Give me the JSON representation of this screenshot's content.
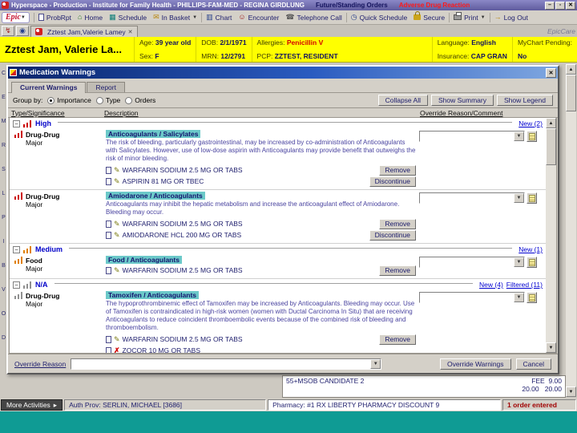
{
  "icons": {
    "close": "✕",
    "minimize": "–",
    "maximize": "▫",
    "dropdown": "▼",
    "up": "▲",
    "down": "▼",
    "collapse": "−",
    "edit": "✎",
    "removed": "✗",
    "home": "⌂",
    "mail": "✉",
    "phone": "☎",
    "clock": "◷",
    "chart": "▥",
    "person": "☺",
    "calendar": "▦",
    "logout": "→",
    "bolt": "↯",
    "globe": "◉",
    "more": "▸",
    "tab_close": "✕"
  },
  "titlebar": {
    "title": "Hyperspace - Production - Institute for Family Health - PHILLIPS-FAM-MED - REGINA GIRDLUNG",
    "alert_orders": "Future/Standing Orders",
    "alert_adr": "Adverse Drug Reaction"
  },
  "toolbar": {
    "epic": "Epic",
    "items": [
      {
        "label": "ProbRpt"
      },
      {
        "label": "Home"
      },
      {
        "label": "Schedule"
      },
      {
        "label": "In Basket"
      },
      {
        "label": "Chart"
      },
      {
        "label": "Encounter"
      },
      {
        "label": "Telephone Call"
      },
      {
        "label": "Quick Schedule"
      },
      {
        "label": "Secure"
      },
      {
        "label": "Print"
      },
      {
        "label": "Log Out"
      }
    ]
  },
  "tabrow": {
    "tab": "Zztest Jam,Valerie Lamey",
    "brand": "EpicCare"
  },
  "patient": {
    "name": "Zztest Jam, Valerie La...",
    "age_label": "Age:",
    "age": "39 year old",
    "sex_label": "Sex:",
    "sex": "F",
    "dob_label": "DOB:",
    "dob": "2/1/1971",
    "mrn_label": "MRN:",
    "mrn": "12/2791",
    "allergies_label": "Allergies:",
    "allergies": "Penicillin V",
    "pcp_label": "PCP:",
    "pcp": "ZZTEST, RESIDENT",
    "language_label": "Language:",
    "language": "English",
    "insurance_label": "Insurance:",
    "insurance": "CAP GRAN",
    "mychart_label": "MyChart Pending:",
    "mychart": "No"
  },
  "activity_letters": [
    "C",
    "E",
    "M",
    "R",
    "S",
    "L",
    "P",
    "I",
    "B",
    "V",
    "O",
    "D"
  ],
  "dialog": {
    "title": "Medication Warnings",
    "tabs": [
      {
        "label": "Current Warnings"
      },
      {
        "label": "Report"
      }
    ],
    "group_by_label": "Group by:",
    "group_options": [
      {
        "label": "Importance"
      },
      {
        "label": "Type"
      },
      {
        "label": "Orders"
      }
    ],
    "collapse_all": "Collapse All",
    "show_summary": "Show Summary",
    "show_legend": "Show Legend",
    "col_type": "Type/Significance",
    "col_desc": "Description",
    "col_override": "Override Reason/Comment",
    "sections": [
      {
        "name": "High",
        "new_link": "New (2)",
        "warnings": [
          {
            "type": "Drug-Drug",
            "significance": "Major",
            "title": "Anticoagulants / Salicylates",
            "body": "The risk of bleeding, particularly gastrointestinal, may be increased by co-administration of Anticoagulants with Salicylates. However, use of low-dose aspirin with Anticoagulants may provide benefit that outweighs the risk of minor bleeding.",
            "meds": [
              {
                "name": "WARFARIN SODIUM 2.5 MG OR TABS",
                "action": "Remove"
              },
              {
                "name": "ASPIRIN 81 MG OR TBEC",
                "action": "Discontinue"
              }
            ]
          },
          {
            "type": "Drug-Drug",
            "significance": "Major",
            "title": "Amiodarone / Anticoagulants",
            "body": "Anticoagulants may inhibit the hepatic metabolism and increase the anticoagulant effect of Amiodarone. Bleeding may occur.",
            "meds": [
              {
                "name": "WARFARIN SODIUM 2.5 MG OR TABS",
                "action": "Remove"
              },
              {
                "name": "AMIODARONE HCL 200 MG OR TABS",
                "action": "Discontinue"
              }
            ]
          }
        ]
      },
      {
        "name": "Medium",
        "new_link": "New (1)",
        "warnings": [
          {
            "type": "Food",
            "significance": "Major",
            "title": "Food / Anticoagulants",
            "meds": [
              {
                "name": "WARFARIN SODIUM 2.5 MG OR TABS",
                "action": "Remove"
              }
            ]
          }
        ]
      },
      {
        "name": "N/A",
        "new_link": "New (4)",
        "filtered_link": "Filtered (11)",
        "warnings": [
          {
            "type": "Drug-Drug",
            "significance": "Major",
            "title": "Tamoxifen / Anticoagulants",
            "body": "The hypoprothrombinemic effect of Tamoxifen may be increased by Anticoagulants. Bleeding may occur. Use of Tamoxifen is contraindicated in high-risk women (women with Ductal Carcinoma In Situ) that are receiving Anticoagulants to reduce coincident thromboembolic events because of the combined risk of bleeding and thromboembolism.",
            "meds": [
              {
                "name": "WARFARIN SODIUM 2.5 MG OR TABS",
                "action": "Remove"
              },
              {
                "name": "ZOCOR 10 MG OR TABS"
              }
            ]
          }
        ]
      }
    ],
    "override_reason_label": "Override Reason",
    "override_warnings_btn": "Override Warnings",
    "cancel_btn": "Cancel"
  },
  "background": {
    "order_line": "55+MSOB CANDIDATE 2",
    "fee_label": "FEE",
    "fee": "9.00",
    "amt1": "20.00",
    "amt2": "20.00"
  },
  "statusbar": {
    "more_activities": "More Activities",
    "auth_prov": "Auth Prov: SERLIN, MICHAEL [3686]",
    "pharmacy": "Pharmacy: #1 RX LIBERTY PHARMACY DISCOUNT 9",
    "orders": "1 order entered"
  }
}
